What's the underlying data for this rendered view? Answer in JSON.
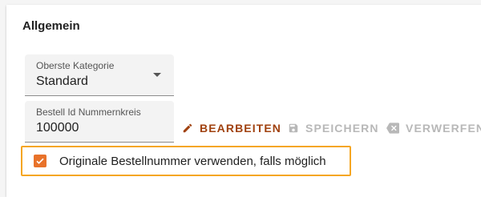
{
  "section": {
    "title": "Allgemein"
  },
  "category_field": {
    "label": "Oberste Kategorie",
    "value": "Standard"
  },
  "order_number_field": {
    "label": "Bestell Id Nummernkreis",
    "value": "100000"
  },
  "actions": {
    "edit_label": "BEARBEITEN",
    "save_label": "SPEICHERN",
    "discard_label": "VERWERFEN"
  },
  "original_number_option": {
    "label": "Originale Bestellnummer verwenden, falls möglich",
    "checked": true
  },
  "icons": {
    "edit": "pencil-icon",
    "save": "floppy-disk-icon",
    "discard": "backspace-x-icon",
    "dropdown": "chevron-down-icon",
    "checkbox": "check-icon"
  },
  "colors": {
    "accent": "#e8722a",
    "edit_action": "#a0410f",
    "disabled_action": "#b8b8b8",
    "highlight_border": "#f5a623"
  }
}
